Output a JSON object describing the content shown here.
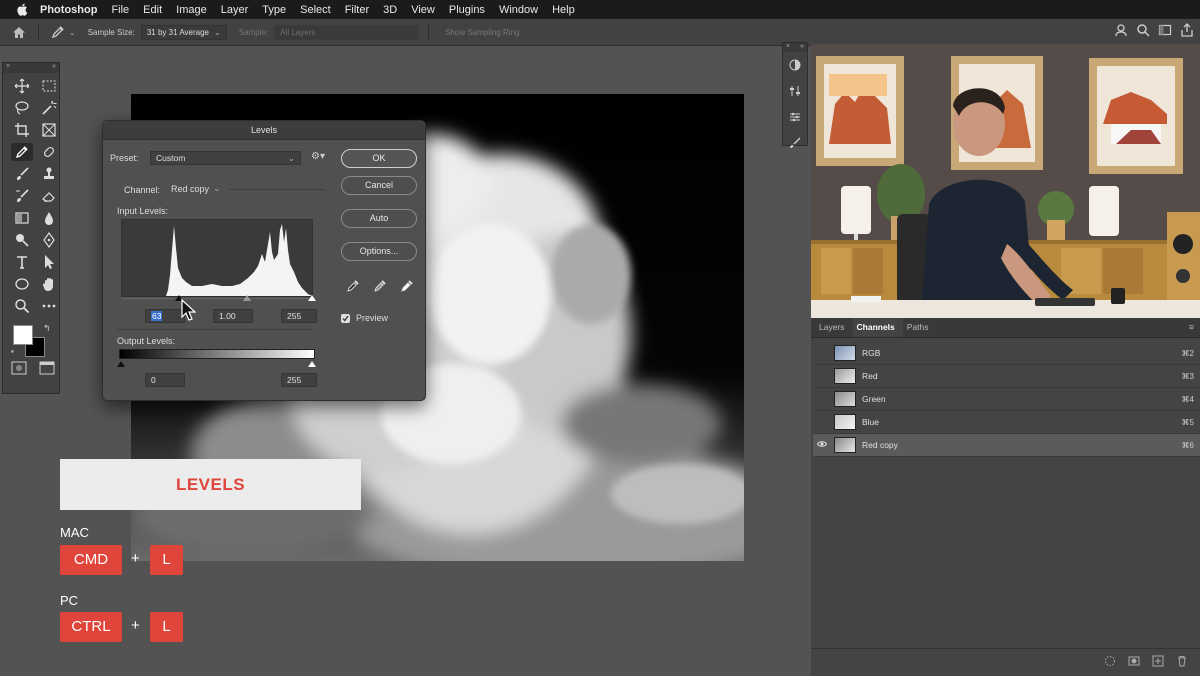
{
  "menubar": {
    "app": "Photoshop",
    "items": [
      "File",
      "Edit",
      "Image",
      "Layer",
      "Type",
      "Select",
      "Filter",
      "3D",
      "View",
      "Plugins",
      "Window",
      "Help"
    ]
  },
  "options": {
    "sample_size_label": "Sample Size:",
    "sample_size_value": "31 by 31 Average",
    "sample_label": "Sample:",
    "sample_value": "All Layers",
    "show_ring": "Show Sampling Ring"
  },
  "levels": {
    "title": "Levels",
    "preset_label": "Preset:",
    "preset_value": "Custom",
    "channel_label": "Channel:",
    "channel_value": "Red copy",
    "input_label": "Input Levels:",
    "input_black": "63",
    "input_gamma": "1.00",
    "input_white": "255",
    "output_label": "Output Levels:",
    "output_black": "0",
    "output_white": "255",
    "ok": "OK",
    "cancel": "Cancel",
    "auto": "Auto",
    "options": "Options...",
    "preview": "Preview",
    "preview_checked": true
  },
  "channels": {
    "tabs": [
      "Layers",
      "Channels",
      "Paths"
    ],
    "active_tab": "Channels",
    "rows": [
      {
        "name": "RGB",
        "key": "⌘2",
        "thumb": "#8fa6c6",
        "selected": false,
        "visible": false
      },
      {
        "name": "Red",
        "key": "⌘3",
        "thumb": "#c9c9c9",
        "selected": false,
        "visible": false
      },
      {
        "name": "Green",
        "key": "⌘4",
        "thumb": "#b4b4b4",
        "selected": false,
        "visible": false
      },
      {
        "name": "Blue",
        "key": "⌘5",
        "thumb": "#e0e0e0",
        "selected": false,
        "visible": false
      },
      {
        "name": "Red copy",
        "key": "⌘6",
        "thumb": "#bdbdbd",
        "selected": true,
        "visible": true
      }
    ]
  },
  "overlay": {
    "title": "LEVELS",
    "mac_label": "MAC",
    "mac_keys": [
      "CMD",
      "L"
    ],
    "pc_label": "PC",
    "pc_keys": [
      "CTRL",
      "L"
    ],
    "plus": "+"
  },
  "colors": {
    "accent_red": "#e0453b",
    "panel": "#424242",
    "canvas_bg": "#535353"
  }
}
